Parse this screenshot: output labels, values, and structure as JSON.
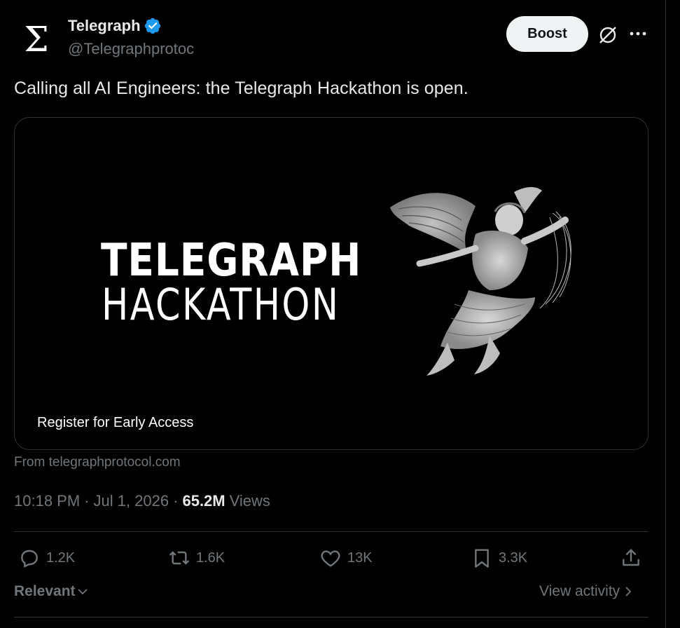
{
  "author": {
    "display_name": "Telegraph",
    "handle": "@Telegraphprotoc",
    "avatar_glyph": "Σ",
    "verified": true,
    "verified_color": "#1d9bf0"
  },
  "header": {
    "boost_label": "Boost",
    "grok_icon": "grok-icon",
    "more_icon": "more-icon"
  },
  "post": {
    "text": "Calling all AI Engineers: the Telegraph Hackathon is open."
  },
  "card": {
    "title_line1": "TELEGRAPH",
    "title_line2": "HACKATHON",
    "caption": "Register for Early Access",
    "image_description_icon": "angel-illustration"
  },
  "source": {
    "from_text": "From telegraphprotocol.com"
  },
  "meta": {
    "time": "10:18 PM",
    "separator": "·",
    "date": "Jul 1, 2026",
    "views_count": "65.2M",
    "views_label": "Views"
  },
  "actions": {
    "replies": "1.2K",
    "reposts": "1.6K",
    "likes": "13K",
    "bookmarks": "3.3K"
  },
  "footer": {
    "relevant_label": "Relevant",
    "view_activity_label": "View activity"
  },
  "colors": {
    "background": "#000000",
    "text_primary": "#e7e9ea",
    "text_secondary": "#71767b",
    "border": "#2f3336",
    "accent": "#1d9bf0"
  }
}
